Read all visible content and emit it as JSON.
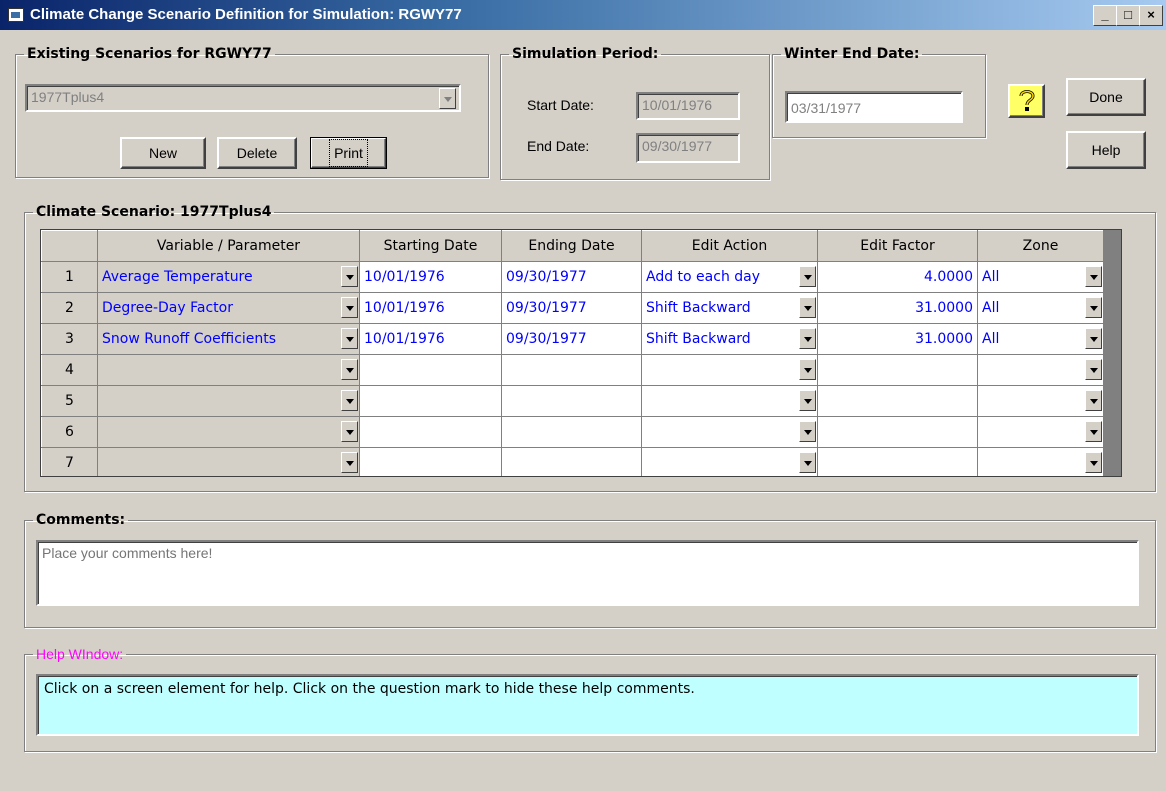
{
  "window": {
    "title": "Climate Change Scenario Definition for Simulation: RGWY77",
    "controls": {
      "minimize": "_",
      "maximize": "□",
      "close": "×"
    }
  },
  "existing": {
    "legend": "Existing Scenarios for RGWY77",
    "selected": "1977Tplus4",
    "buttons": {
      "new": "New",
      "delete": "Delete",
      "print": "Print"
    }
  },
  "simulation": {
    "legend": "Simulation Period:",
    "start_label": "Start Date:",
    "start_value": "10/01/1976",
    "end_label": "End Date:",
    "end_value": "09/30/1977"
  },
  "winter": {
    "legend": "Winter End Date:",
    "value": "03/31/1977"
  },
  "side_buttons": {
    "done": "Done",
    "help": "Help"
  },
  "scenario": {
    "legend": "Climate Scenario: 1977Tplus4",
    "columns": [
      "Variable / Parameter",
      "Starting Date",
      "Ending Date",
      "Edit Action",
      "Edit Factor",
      "Zone"
    ],
    "rows": [
      {
        "n": "1",
        "variable": "Average Temperature",
        "start": "10/01/1976",
        "end": "09/30/1977",
        "action": "Add to each day",
        "factor": "4.0000",
        "zone": "All"
      },
      {
        "n": "2",
        "variable": "Degree-Day Factor",
        "start": "10/01/1976",
        "end": "09/30/1977",
        "action": "Shift Backward",
        "factor": "31.0000",
        "zone": "All"
      },
      {
        "n": "3",
        "variable": "Snow Runoff Coefficients",
        "start": "10/01/1976",
        "end": "09/30/1977",
        "action": "Shift Backward",
        "factor": "31.0000",
        "zone": "All"
      },
      {
        "n": "4",
        "variable": "",
        "start": "",
        "end": "",
        "action": "",
        "factor": "",
        "zone": ""
      },
      {
        "n": "5",
        "variable": "",
        "start": "",
        "end": "",
        "action": "",
        "factor": "",
        "zone": ""
      },
      {
        "n": "6",
        "variable": "",
        "start": "",
        "end": "",
        "action": "",
        "factor": "",
        "zone": ""
      },
      {
        "n": "7",
        "variable": "",
        "start": "",
        "end": "",
        "action": "",
        "factor": "",
        "zone": ""
      }
    ]
  },
  "comments": {
    "legend": "Comments:",
    "placeholder": "Place your comments here!"
  },
  "help_window": {
    "legend": "Help WIndow:",
    "text": "Click on a screen element for help.  Click on the question mark to hide these help comments.",
    "legend_color": "#ff00ff",
    "background": "#c0ffff"
  }
}
